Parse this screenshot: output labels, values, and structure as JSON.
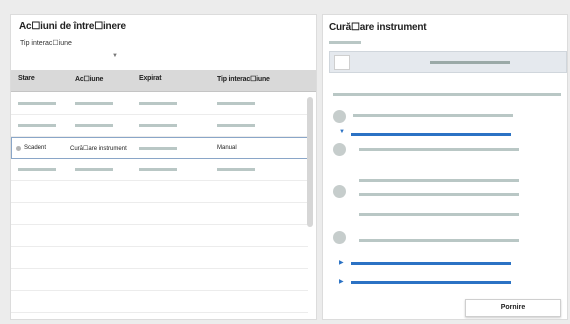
{
  "left_panel": {
    "title": "Ac☐iuni de între☐inere",
    "filter": {
      "label": "Tip interac☐iune"
    },
    "columns": [
      "Stare",
      "Ac☐iune",
      "Expirat",
      "Tip interac☐iune"
    ],
    "selected_row": {
      "status": "Scadent",
      "action": "Cură☐are instrument",
      "type": "Manual"
    }
  },
  "right_panel": {
    "title": "Cură☐are instrument",
    "start_button": "Pornire"
  },
  "colors": {
    "placeholder": "#b9c7c5",
    "accent_blue": "#2b72c4",
    "header_bg": "#d9d9d9"
  },
  "icons": [
    "chevron-down-icon",
    "status-dot-icon",
    "triangle-down-icon",
    "triangle-right-icon"
  ]
}
